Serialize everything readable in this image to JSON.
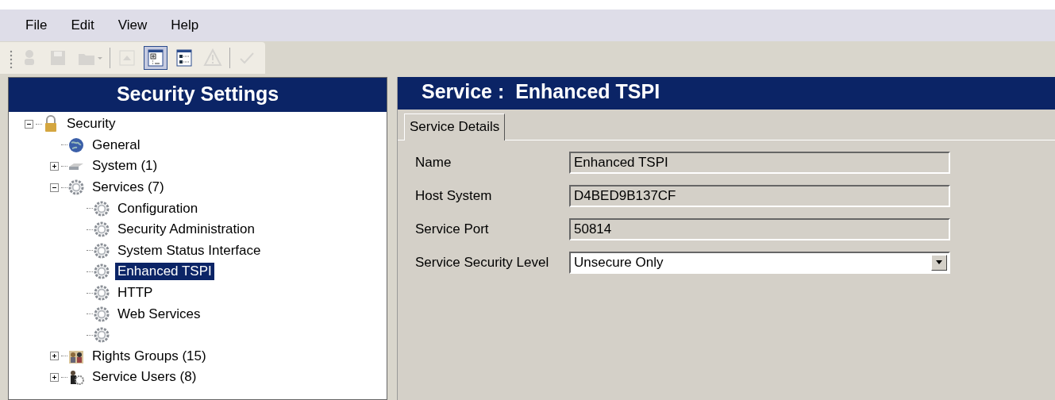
{
  "menu": [
    "File",
    "Edit",
    "View",
    "Help"
  ],
  "toolbar": [
    {
      "kind": "user",
      "disabled": true,
      "pressed": false
    },
    {
      "kind": "save",
      "disabled": true,
      "pressed": false
    },
    {
      "kind": "folder",
      "disabled": true,
      "pressed": false
    },
    {
      "kind": "separator"
    },
    {
      "kind": "up",
      "disabled": true,
      "pressed": false
    },
    {
      "kind": "tree",
      "disabled": false,
      "pressed": true
    },
    {
      "kind": "list",
      "disabled": false,
      "pressed": false
    },
    {
      "kind": "warning",
      "disabled": true,
      "pressed": false
    },
    {
      "kind": "separator"
    },
    {
      "kind": "check",
      "disabled": true,
      "pressed": false
    }
  ],
  "left_panel": {
    "title": "Security Settings",
    "tree": [
      {
        "label": "Security",
        "kind": "lock",
        "expanded": true,
        "selected": false,
        "children": [
          {
            "label": "General",
            "kind": "globe",
            "selected": false
          },
          {
            "label": "System (1)",
            "kind": "device",
            "expanded": false,
            "selected": false
          },
          {
            "label": "Services (7)",
            "kind": "gear",
            "expanded": true,
            "selected": false,
            "children": [
              {
                "label": "Configuration",
                "kind": "gear",
                "selected": false
              },
              {
                "label": "Security Administration",
                "kind": "gear",
                "selected": false
              },
              {
                "label": "System Status Interface",
                "kind": "gear",
                "selected": false
              },
              {
                "label": "Enhanced TSPI",
                "kind": "gear",
                "selected": true
              },
              {
                "label": "HTTP",
                "kind": "gear",
                "selected": false
              },
              {
                "label": "Web Services",
                "kind": "gear",
                "selected": false
              },
              {
                "kind": "gear",
                "selected": false
              }
            ]
          },
          {
            "label": "Rights Groups (15)",
            "kind": "group",
            "expanded": false,
            "selected": false
          },
          {
            "label": "Service Users (8)",
            "kind": "users",
            "expanded": false,
            "selected": false
          }
        ]
      }
    ]
  },
  "right_panel": {
    "title": "Service :  Enhanced TSPI",
    "tabs": [
      {
        "label": "Service Details",
        "selected": true
      }
    ],
    "fields": [
      {
        "kind": "text",
        "label": "Name",
        "value": "Enhanced TSPI"
      },
      {
        "kind": "text",
        "label": "Host System",
        "value": "D4BED9B137CF"
      },
      {
        "kind": "text",
        "label": "Service Port",
        "value": "50814"
      },
      {
        "kind": "select",
        "label": "Service Security Level",
        "value": "Unsecure Only"
      }
    ]
  }
}
